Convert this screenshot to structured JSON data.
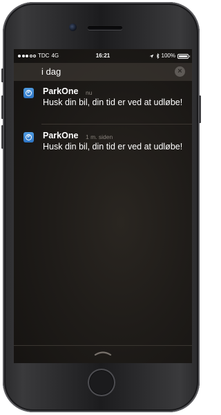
{
  "status_bar": {
    "carrier": "TDC",
    "network": "4G",
    "time": "16:21",
    "battery_percent": "100%",
    "signal_bars_filled": 3,
    "signal_bars_total": 5,
    "battery_level": 1.0
  },
  "notification_center": {
    "section_title": "i dag",
    "clear_icon": "close-icon",
    "notifications": [
      {
        "app_name": "ParkOne",
        "time": "nu",
        "message": "Husk din bil, din tid er ved at udløbe!",
        "icon": "parking-icon"
      },
      {
        "app_name": "ParkOne",
        "time": "1 m. siden",
        "message": "Husk din bil, din tid er ved at udløbe!",
        "icon": "parking-icon"
      }
    ]
  },
  "colors": {
    "app_icon": "#3a86d6",
    "background": "#1f1c19",
    "secondary_text": "#8a847d"
  }
}
